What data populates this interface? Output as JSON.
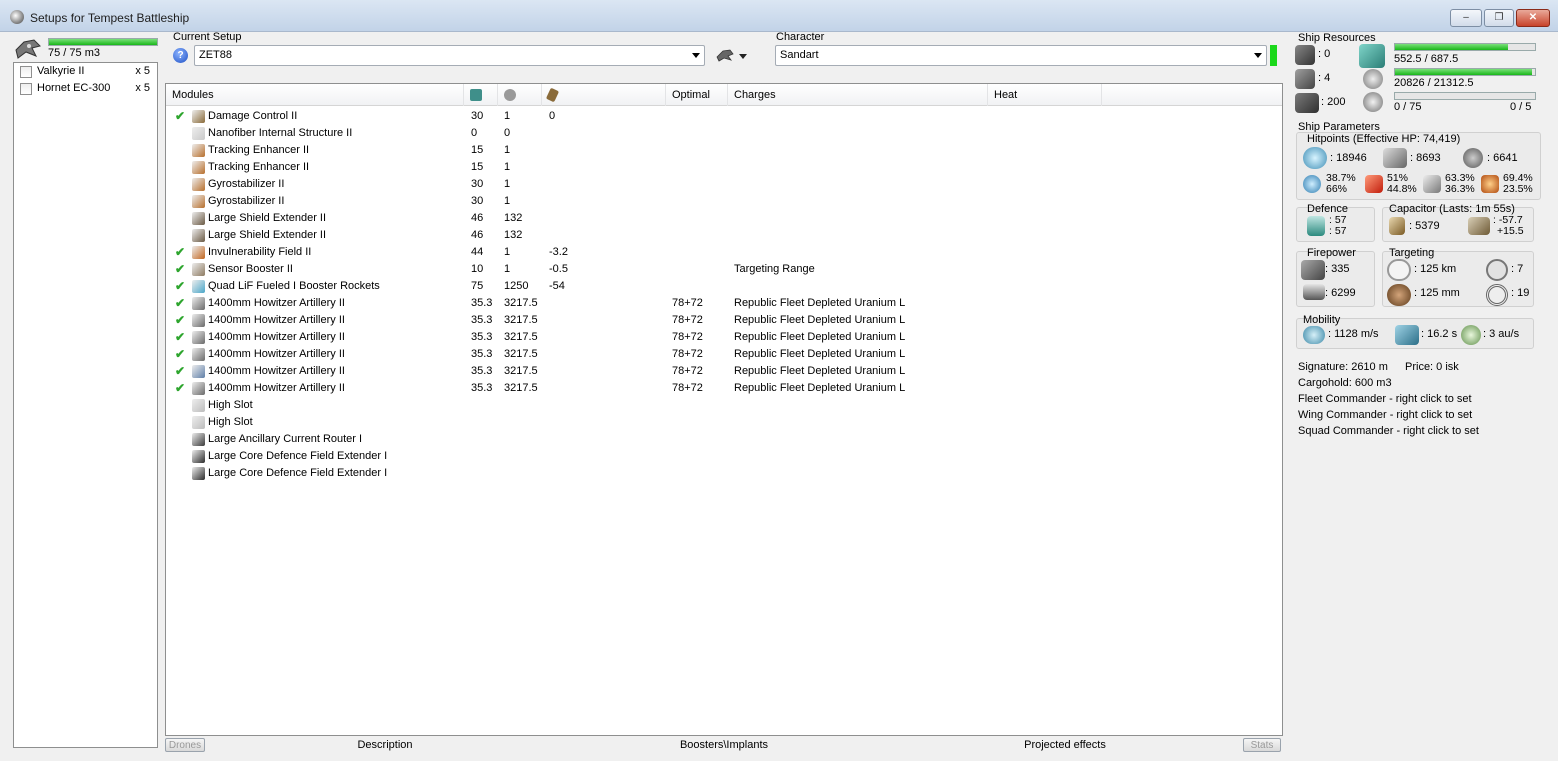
{
  "window": {
    "title": "Setups for Tempest Battleship",
    "min": "–",
    "max": "❐",
    "close": "✕"
  },
  "left": {
    "cargo_text": "75 / 75 m3",
    "cargo_fill": 1.0,
    "drones": [
      {
        "name": "Valkyrie II",
        "qty": "x 5"
      },
      {
        "name": "Hornet EC-300",
        "qty": "x 5"
      }
    ]
  },
  "setup": {
    "label": "Current Setup",
    "value": "ZET88",
    "help_icon": "?",
    "character_label": "Character",
    "character_value": "Sandart"
  },
  "grid": {
    "headers": {
      "modules": "Modules",
      "optimal": "Optimal",
      "charges": "Charges",
      "heat": "Heat"
    },
    "header_icons": [
      "cpu-icon",
      "powergrid-icon",
      "capacitor-icon"
    ],
    "rows": [
      {
        "check": "✔",
        "name": "Damage Control II",
        "cpu": "30",
        "pg": "1",
        "cap": "0",
        "optimal": "",
        "charge": "",
        "color": "#8a6b3a"
      },
      {
        "check": "",
        "name": "Nanofiber Internal Structure II",
        "cpu": "0",
        "pg": "0",
        "cap": "",
        "optimal": "",
        "charge": "",
        "color": "#c9c9c9"
      },
      {
        "check": "",
        "name": "Tracking Enhancer II",
        "cpu": "15",
        "pg": "1",
        "cap": "",
        "optimal": "",
        "charge": "",
        "color": "#b86f2c"
      },
      {
        "check": "",
        "name": "Tracking Enhancer II",
        "cpu": "15",
        "pg": "1",
        "cap": "",
        "optimal": "",
        "charge": "",
        "color": "#b86f2c"
      },
      {
        "check": "",
        "name": "Gyrostabilizer II",
        "cpu": "30",
        "pg": "1",
        "cap": "",
        "optimal": "",
        "charge": "",
        "color": "#b86f2c"
      },
      {
        "check": "",
        "name": "Gyrostabilizer II",
        "cpu": "30",
        "pg": "1",
        "cap": "",
        "optimal": "",
        "charge": "",
        "color": "#b86f2c"
      },
      {
        "check": "",
        "name": "Large Shield Extender II",
        "cpu": "46",
        "pg": "132",
        "cap": "",
        "optimal": "",
        "charge": "",
        "color": "#6b5a44"
      },
      {
        "check": "",
        "name": "Large Shield Extender II",
        "cpu": "46",
        "pg": "132",
        "cap": "",
        "optimal": "",
        "charge": "",
        "color": "#6b5a44"
      },
      {
        "check": "✔",
        "name": "Invulnerability Field II",
        "cpu": "44",
        "pg": "1",
        "cap": "-3.2",
        "optimal": "",
        "charge": "",
        "color": "#c2661f"
      },
      {
        "check": "✔",
        "name": "Sensor Booster II",
        "cpu": "10",
        "pg": "1",
        "cap": "-0.5",
        "optimal": "",
        "charge": "Targeting Range",
        "color": "#8d7a60"
      },
      {
        "check": "✔",
        "name": "Quad LiF Fueled I Booster Rockets",
        "cpu": "75",
        "pg": "1250",
        "cap": "-54",
        "optimal": "",
        "charge": "",
        "color": "#4aa6c8"
      },
      {
        "check": "✔",
        "name": "1400mm Howitzer Artillery II",
        "cpu": "35.3",
        "pg": "3217.5",
        "cap": "",
        "optimal": "78+72",
        "charge": "Republic Fleet Depleted Uranium L",
        "color": "#6a6a6a"
      },
      {
        "check": "✔",
        "name": "1400mm Howitzer Artillery II",
        "cpu": "35.3",
        "pg": "3217.5",
        "cap": "",
        "optimal": "78+72",
        "charge": "Republic Fleet Depleted Uranium L",
        "color": "#6a6a6a"
      },
      {
        "check": "✔",
        "name": "1400mm Howitzer Artillery II",
        "cpu": "35.3",
        "pg": "3217.5",
        "cap": "",
        "optimal": "78+72",
        "charge": "Republic Fleet Depleted Uranium L",
        "color": "#6a6a6a"
      },
      {
        "check": "✔",
        "name": "1400mm Howitzer Artillery II",
        "cpu": "35.3",
        "pg": "3217.5",
        "cap": "",
        "optimal": "78+72",
        "charge": "Republic Fleet Depleted Uranium L",
        "color": "#6a6a6a"
      },
      {
        "check": "✔",
        "name": "1400mm Howitzer Artillery II",
        "cpu": "35.3",
        "pg": "3217.5",
        "cap": "",
        "optimal": "78+72",
        "charge": "Republic Fleet Depleted Uranium L",
        "color": "#5f7fa8"
      },
      {
        "check": "✔",
        "name": "1400mm Howitzer Artillery II",
        "cpu": "35.3",
        "pg": "3217.5",
        "cap": "",
        "optimal": "78+72",
        "charge": "Republic Fleet Depleted Uranium L",
        "color": "#6a6a6a"
      },
      {
        "check": "",
        "name": "High Slot",
        "cpu": "",
        "pg": "",
        "cap": "",
        "optimal": "",
        "charge": "",
        "color": "#bdbdbd"
      },
      {
        "check": "",
        "name": "High Slot",
        "cpu": "",
        "pg": "",
        "cap": "",
        "optimal": "",
        "charge": "",
        "color": "#bdbdbd"
      },
      {
        "check": "",
        "name": "Large Ancillary Current Router I",
        "cpu": "",
        "pg": "",
        "cap": "",
        "optimal": "",
        "charge": "",
        "color": "#3a3a3a"
      },
      {
        "check": "",
        "name": "Large Core Defence Field Extender I",
        "cpu": "",
        "pg": "",
        "cap": "",
        "optimal": "",
        "charge": "",
        "color": "#2b2b2b"
      },
      {
        "check": "",
        "name": "Large Core Defence Field Extender I",
        "cpu": "",
        "pg": "",
        "cap": "",
        "optimal": "",
        "charge": "",
        "color": "#2b2b2b"
      }
    ],
    "footer": {
      "drones": "Drones",
      "description": "Description",
      "boosters": "Boosters\\Implants",
      "projected": "Projected effects",
      "stats": "Stats"
    }
  },
  "resources": {
    "label": "Ship Resources",
    "turret": ": 0",
    "launcher": ": 4",
    "calibration": ": 200",
    "cpu_text": "552.5 / 687.5",
    "cpu_fill": 0.8036,
    "pg_text": "20826 / 21312.5",
    "pg_fill": 0.9772,
    "drone_bay_text": "0 / 75",
    "drone_bw_text": "0 / 5",
    "drone_fill": 0.0
  },
  "params": {
    "label": "Ship Parameters",
    "hitpoints_label": "Hitpoints (Effective HP: 74,419)",
    "shield_hp": ": 18946",
    "armor_hp": ": 8693",
    "hull_hp": ": 6641",
    "em": [
      "38.7%",
      "66%"
    ],
    "thermal": [
      "51%",
      "44.8%"
    ],
    "kinetic": [
      "63.3%",
      "36.3%"
    ],
    "explosive": [
      "69.4%",
      "23.5%"
    ],
    "defence_label": "Defence",
    "defence_vals": [
      ": 57",
      ": 57"
    ],
    "capacitor_label": "Capacitor (Lasts: 1m 55s)",
    "capacitor_value": ": 5379",
    "capacitor_delta": [
      ": -57.7",
      "+15.5"
    ],
    "firepower_label": "Firepower",
    "dps": ": 335",
    "volley": ": 6299",
    "targeting_label": "Targeting",
    "target_range": ": 125 km",
    "max_targets": ": 7",
    "scan_res": ": 125 mm",
    "sensor_strength": ": 19",
    "mobility_label": "Mobility",
    "speed": ": 1128 m/s",
    "align": ": 16.2 s",
    "warp": ": 3 au/s"
  },
  "info": {
    "signature": "Signature: 2610 m",
    "price": "Price: 0 isk",
    "cargohold": "Cargohold: 600 m3",
    "fleet": "Fleet Commander - right click to set",
    "wing": "Wing Commander - right click to set",
    "squad": "Squad Commander - right click to set"
  }
}
